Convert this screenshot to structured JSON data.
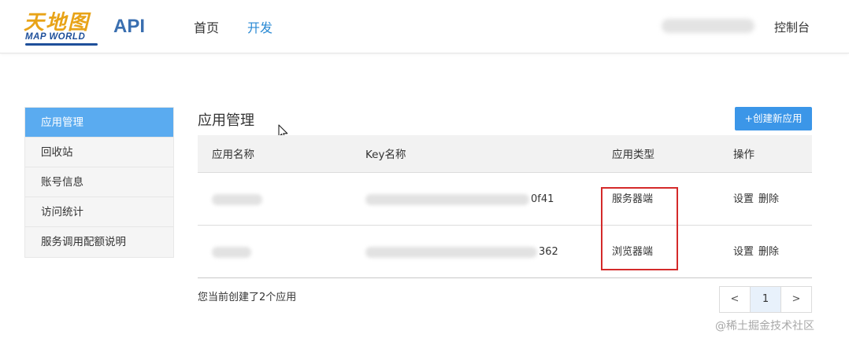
{
  "header": {
    "logo_cn": "天地图",
    "logo_en": "MAP WORLD",
    "api_label": "API",
    "nav": [
      {
        "label": "首页"
      },
      {
        "label": "开发"
      }
    ],
    "console_label": "控制台"
  },
  "sidebar": {
    "items": [
      {
        "label": "应用管理"
      },
      {
        "label": "回收站"
      },
      {
        "label": "账号信息"
      },
      {
        "label": "访问统计"
      },
      {
        "label": "服务调用配额说明"
      }
    ]
  },
  "main": {
    "title": "应用管理",
    "create_button": "+创建新应用",
    "table": {
      "headers": [
        "应用名称",
        "Key名称",
        "应用类型",
        "操作"
      ],
      "rows": [
        {
          "key_suffix": "0f41",
          "type": "服务器端",
          "action_settings": "设置",
          "action_delete": "删除"
        },
        {
          "key_suffix": "362",
          "type": "浏览器端",
          "action_settings": "设置",
          "action_delete": "删除"
        }
      ]
    },
    "summary": "您当前创建了2个应用",
    "pagination": {
      "prev": "<",
      "current": "1",
      "next": ">"
    }
  },
  "watermark": "@稀土掘金技术社区",
  "colors": {
    "accent": "#3b96e8",
    "sidebar_active": "#5aabf0",
    "nav_active": "#2a8ad4",
    "highlight_box": "#d42a2a"
  }
}
